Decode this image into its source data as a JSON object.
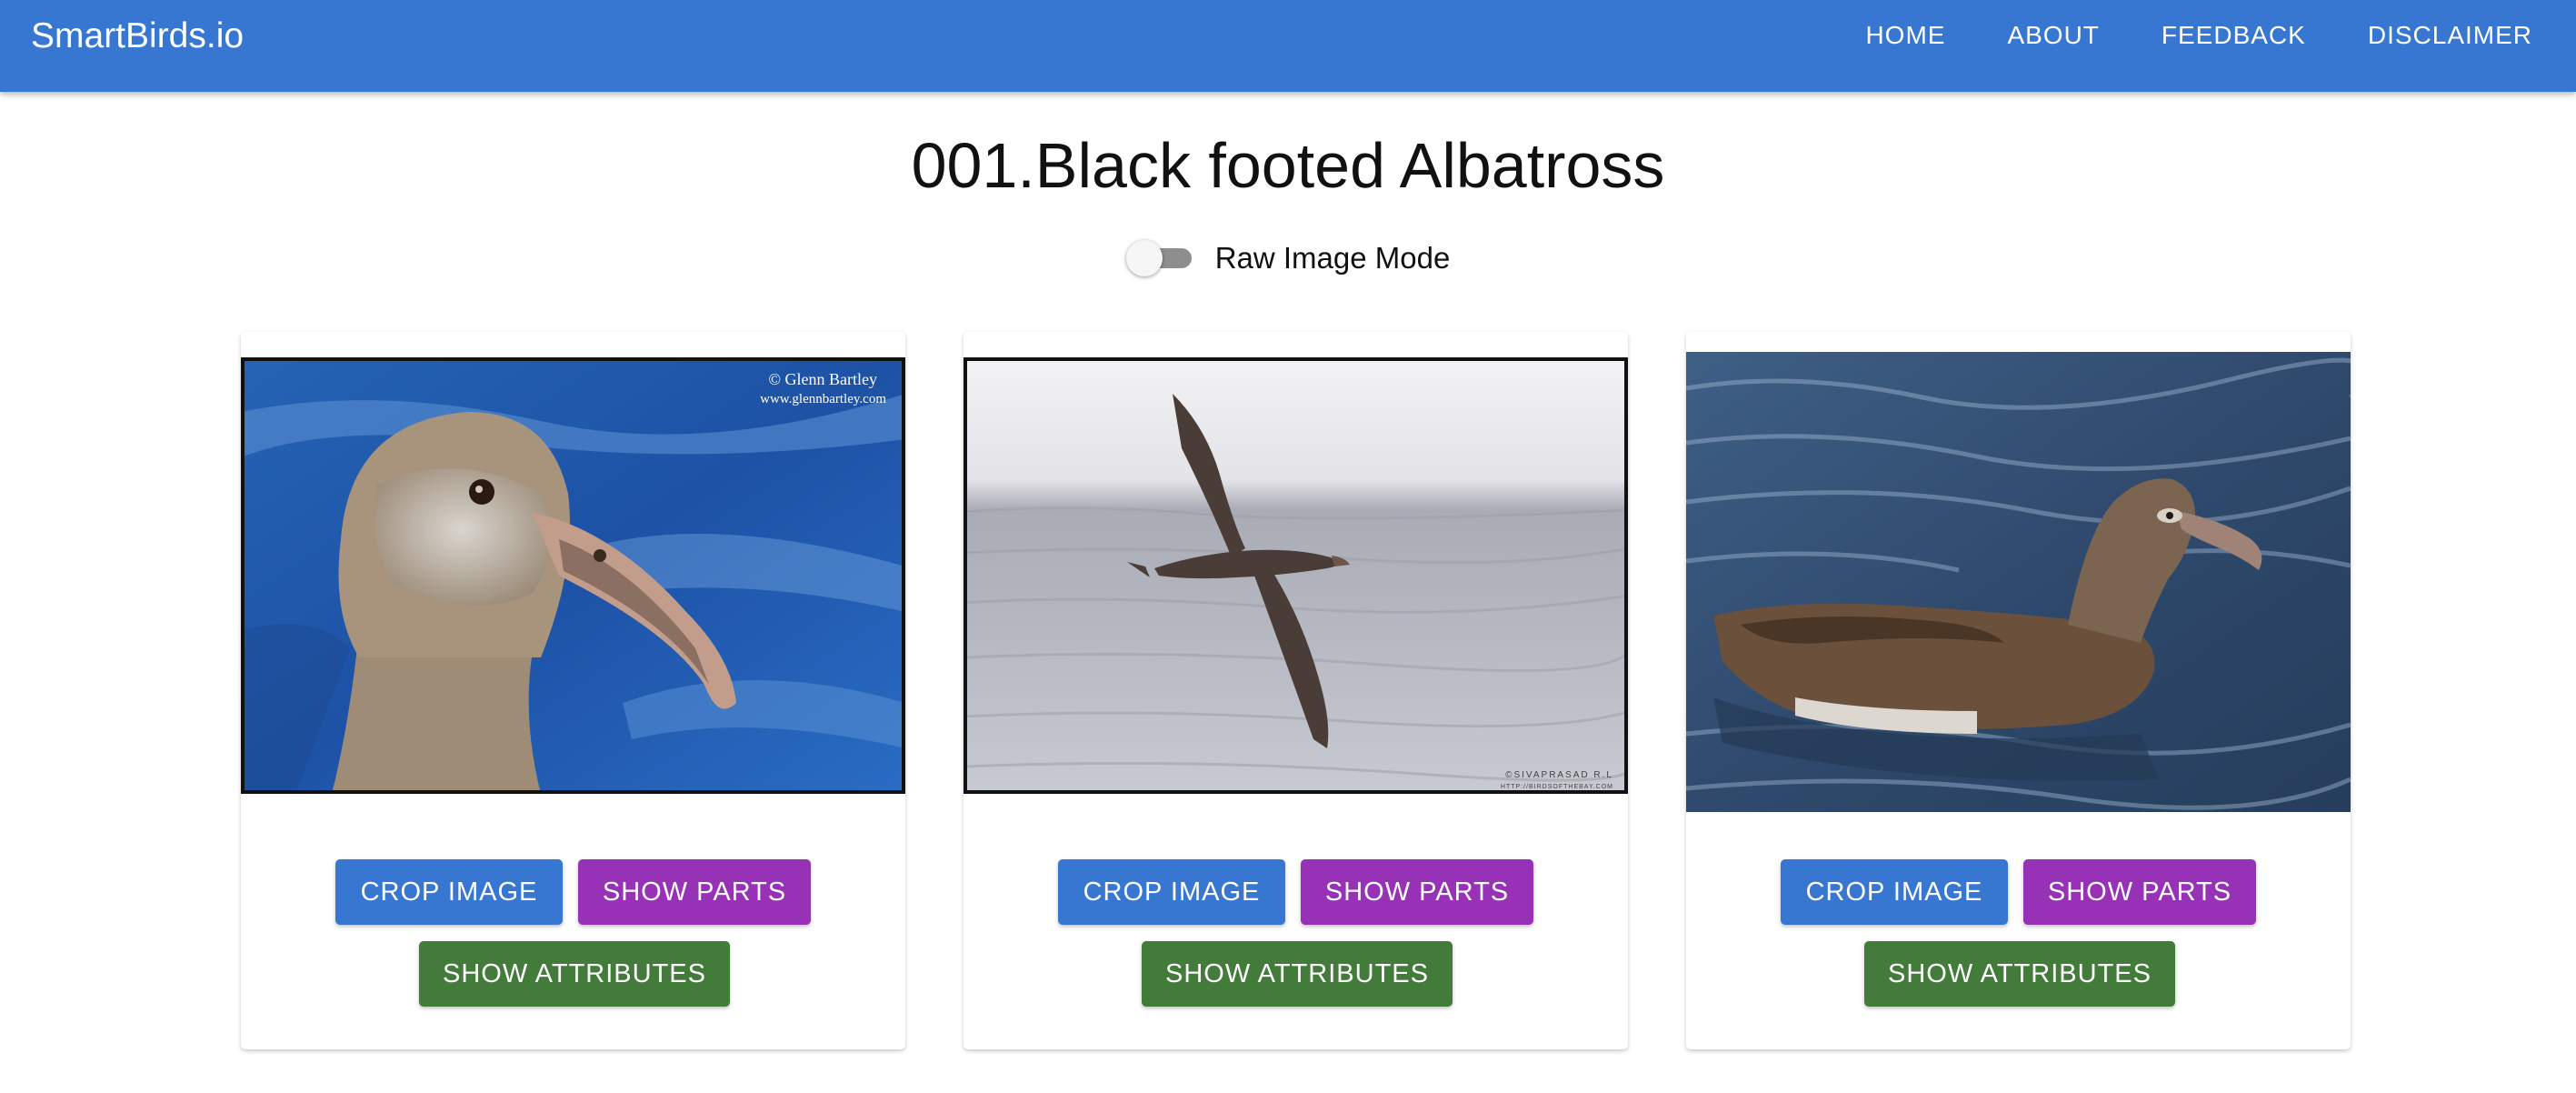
{
  "navbar": {
    "brand": "SmartBirds.io",
    "links": [
      "HOME",
      "ABOUT",
      "FEEDBACK",
      "DISCLAIMER"
    ]
  },
  "page": {
    "title": "001.Black footed Albatross",
    "toggle_label": "Raw Image Mode",
    "toggle_on": false
  },
  "cards": [
    {
      "image_alt": "Black-footed albatross head close-up over blue water",
      "watermark_line1": "© Glenn Bartley",
      "watermark_line2": "www.glennbartley.com",
      "crop_label": "CROP IMAGE",
      "parts_label": "SHOW PARTS",
      "attributes_label": "SHOW ATTRIBUTES"
    },
    {
      "image_alt": "Black-footed albatross in flight over grey sea",
      "watermark_line1": "©SIVAPRASAD R.L",
      "watermark_line2": "HTTP://BIRDSOFTHEBAY.COM",
      "crop_label": "CROP IMAGE",
      "parts_label": "SHOW PARTS",
      "attributes_label": "SHOW ATTRIBUTES"
    },
    {
      "image_alt": "Black-footed albatross floating on dark water",
      "crop_label": "CROP IMAGE",
      "parts_label": "SHOW PARTS",
      "attributes_label": "SHOW ATTRIBUTES"
    }
  ],
  "colors": {
    "navbar": "#3777d1",
    "crop_button": "#3777d1",
    "parts_button": "#9731b5",
    "attributes_button": "#427b3a",
    "toggle_track": "#8e8e8e"
  }
}
